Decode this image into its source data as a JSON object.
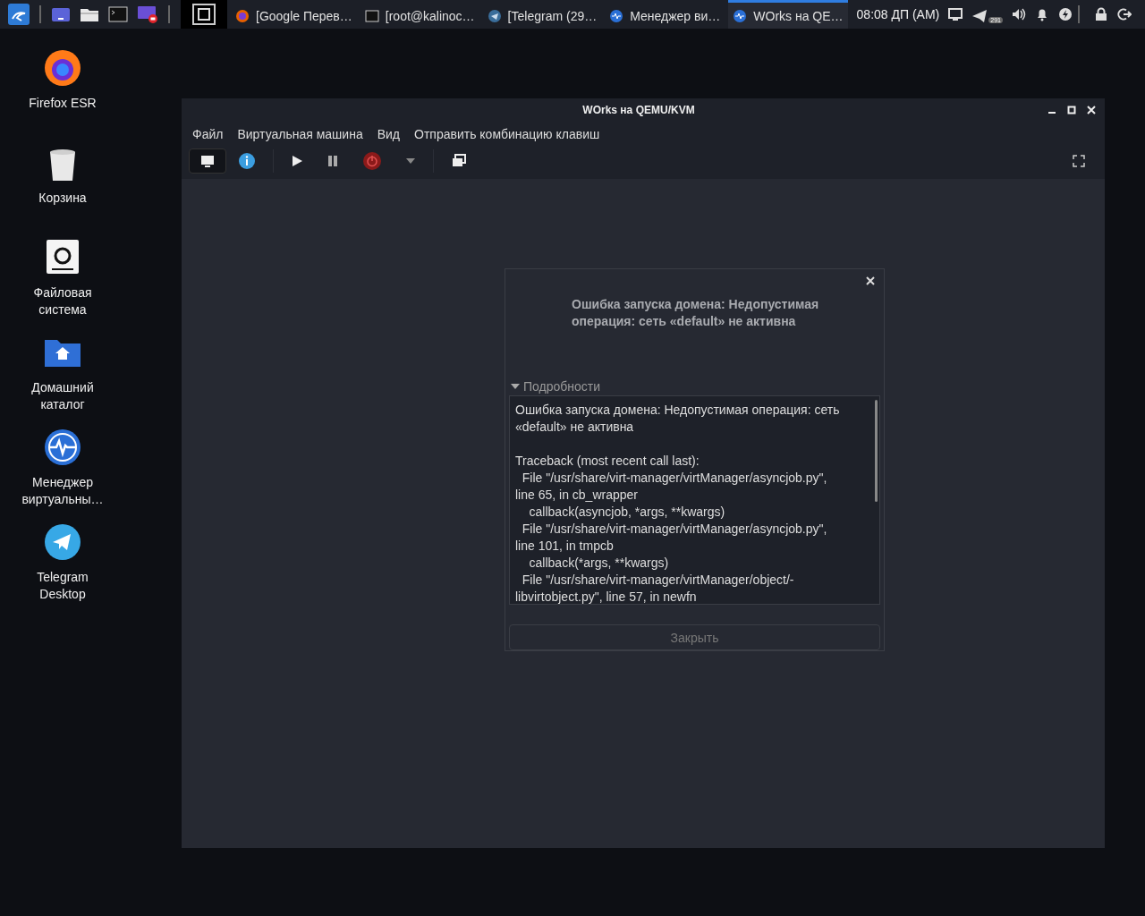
{
  "taskbar": {
    "workspaces": [
      {
        "selected": true
      }
    ],
    "windows": [
      {
        "title": "[Google Перев…",
        "selected": false
      },
      {
        "title": "[root@kalinoc…",
        "selected": false
      },
      {
        "title": "[Telegram (29…",
        "selected": false
      },
      {
        "title": "Менеджер ви…",
        "selected": false
      },
      {
        "title": "WOrks на QE…",
        "selected": true
      }
    ],
    "clock": "08:08 ДП (AM)",
    "tray_badge": "291"
  },
  "desktop_icons": [
    {
      "label": "Firefox ESR"
    },
    {
      "label": "Корзина"
    },
    {
      "label": "Файловая система"
    },
    {
      "label": "Домашний каталог"
    },
    {
      "label": "Менеджер виртуальны…"
    },
    {
      "label": "Telegram Desktop"
    }
  ],
  "window": {
    "title": "WOrks на QEMU/KVM",
    "menu": [
      "Файл",
      "Виртуальная машина",
      "Вид",
      "Отправить комбинацию клавиш"
    ],
    "toolbar": [
      {
        "kind": "view",
        "selected": true
      },
      {
        "kind": "view",
        "selected": false
      },
      {
        "kind": "play"
      },
      {
        "kind": "pause"
      },
      {
        "kind": "power"
      },
      {
        "kind": "dropdown"
      },
      {
        "kind": "snapshot"
      }
    ]
  },
  "dialog": {
    "message": "Ошибка запуска домена: Недопустимая операция: сеть «default» не активна",
    "details": {
      "label": "Подробности",
      "expanded": true,
      "lines": [
        {
          "text": "Ошибка запуска домена: Недопустимая операция: сеть",
          "gap_before": false
        },
        {
          "text": "«default» не активна",
          "gap_before": false
        },
        {
          "text": "Traceback (most recent call last):",
          "gap_before": true
        },
        {
          "text": "  File \"/usr/share/virt-manager/virtManager/asyncjob.py\",",
          "gap_before": false
        },
        {
          "text": "line 65, in cb_wrapper",
          "gap_before": false
        },
        {
          "text": "    callback(asyncjob, *args, **kwargs)",
          "gap_before": false
        },
        {
          "text": "  File \"/usr/share/virt-manager/virtManager/asyncjob.py\",",
          "gap_before": false
        },
        {
          "text": "line 101, in tmpcb",
          "gap_before": false
        },
        {
          "text": "    callback(*args, **kwargs)",
          "gap_before": false
        },
        {
          "text": "  File \"/usr/share/virt-manager/virtManager/object/-",
          "gap_before": false
        },
        {
          "text": "libvirtobject.py\", line 57, in newfn",
          "gap_before": false
        }
      ]
    },
    "button": "Закрыть"
  }
}
